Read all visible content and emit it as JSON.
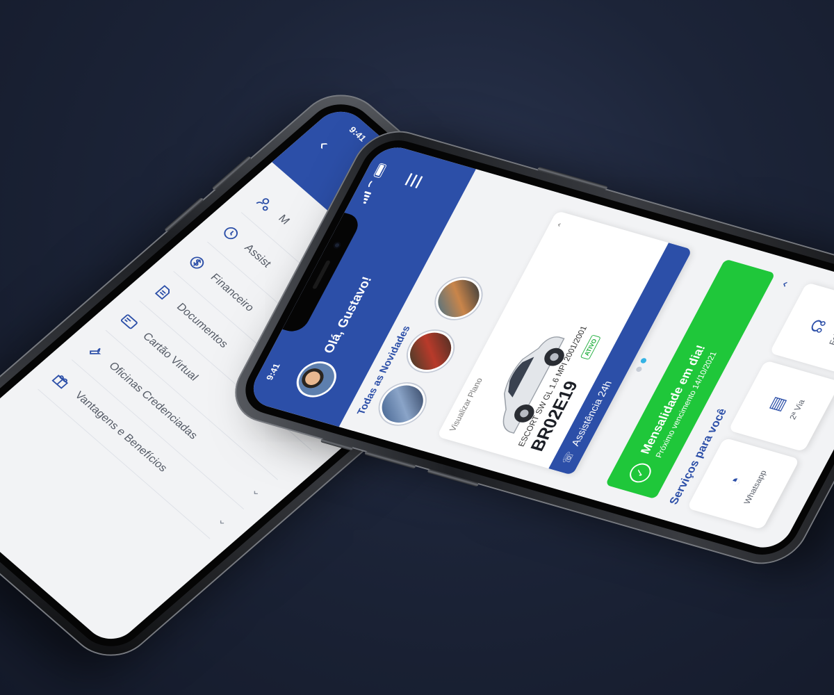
{
  "colors": {
    "brand_blue": "#2c4fa8",
    "success_green": "#1fc73a",
    "background": "#1c2438",
    "status_ativo": "#1fae3c"
  },
  "statusbar": {
    "time": "9:41"
  },
  "back_phone": {
    "header": {
      "back_icon": "back-arrow-icon",
      "menu_icon": "hamburger-icon"
    },
    "menu": {
      "items": [
        {
          "label": "M",
          "icon": "user-settings-icon"
        },
        {
          "label": "Assist",
          "icon": "assistance-clock-icon"
        },
        {
          "label": "Financeiro",
          "icon": "dollar-icon"
        },
        {
          "label": "Documentos",
          "icon": "document-icon"
        },
        {
          "label": "Cartão Virtual",
          "icon": "card-icon"
        },
        {
          "label": "Oficinas Credenciadas",
          "icon": "wrench-icon"
        },
        {
          "label": "Vantagens e Benefícios",
          "icon": "gift-icon"
        }
      ]
    }
  },
  "front_phone": {
    "header": {
      "greeting": "Olá, Gustavo!",
      "menu_icon": "hamburger-icon"
    },
    "news": {
      "title": "Todas as Novidades"
    },
    "plan_card": {
      "link_label": "Visualizar Plano",
      "model": "ESCORT SW GL 1.6 MPI 2001/2001",
      "plate": "BR02E19",
      "status": "ATIVO",
      "assist_label": "Assistência 24h"
    },
    "payment_status": {
      "title": "Mensalidade em dia!",
      "subtitle": "Próximo vencimento 14/10/2021"
    },
    "services": {
      "title": "Serviços para você",
      "items": [
        {
          "label": "Whatsapp",
          "icon": "whatsapp-icon"
        },
        {
          "label": "2ª Via",
          "icon": "invoice-icon"
        },
        {
          "label": "Fale Co",
          "icon": "headset-icon"
        }
      ]
    }
  }
}
